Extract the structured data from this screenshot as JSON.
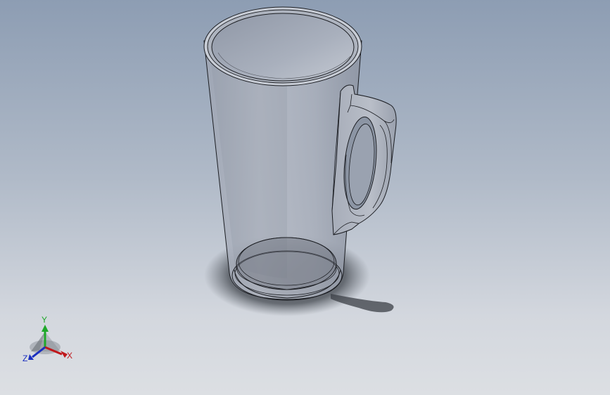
{
  "viewport": {
    "background_top": "#8d9db3",
    "background_bottom": "#dcdfe3"
  },
  "model": {
    "part": "mug",
    "features": [
      "body",
      "rim",
      "handle",
      "base",
      "shadow"
    ]
  },
  "triad": {
    "x_label": "X",
    "y_label": "Y",
    "z_label": "Z",
    "x_color": "#c0181c",
    "y_color": "#1fa82a",
    "z_color": "#1a2fc0"
  }
}
